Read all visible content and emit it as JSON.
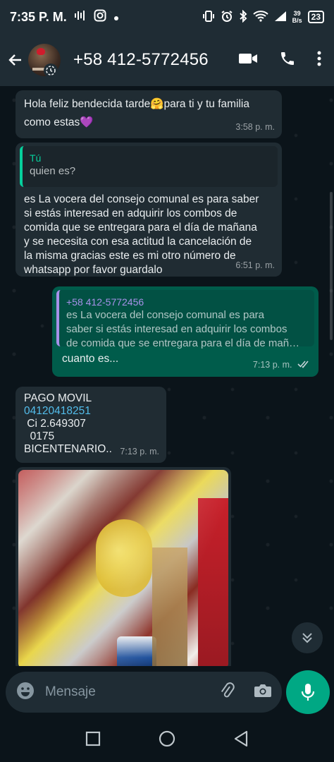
{
  "status_bar": {
    "time": "7:35 P. M.",
    "net_speed_value": "39",
    "net_speed_unit": "B/s",
    "battery": "23"
  },
  "header": {
    "contact": "+58 412-5772456",
    "icons": [
      "back-arrow-icon",
      "video-call-icon",
      "voice-call-icon",
      "more-options-icon"
    ]
  },
  "messages": [
    {
      "direction": "incoming",
      "text_line1": "Hola feliz bendecida tarde🤗para ti y tu familia",
      "text_line2": "como estas💜",
      "time": "3:58 p. m."
    },
    {
      "direction": "incoming",
      "quote_author": "Tú",
      "quote_text": "quien es?",
      "text_lines": [
        "es La vocera del consejo comunal  es para saber",
        "si estás interesad en adquirir los combos  de",
        "comida que se entregara para el día de mañana",
        "y se necesita con esa actitud la cancelación de",
        "la misma gracias este es mi otro número de",
        "whatsapp por favor guardalo"
      ],
      "time": "6:51 p. m."
    },
    {
      "direction": "outgoing",
      "quote_author": "+58 412-5772456",
      "quote_lines": [
        "es La vocera del consejo comunal  es para",
        "saber si estás interesad en adquirir los combos",
        "de comida que se entregara para el día de mañ…"
      ],
      "text": "cuanto es...",
      "time": "7:13 p. m.",
      "status": "read"
    },
    {
      "direction": "incoming",
      "line1": "PAGO MOVIL",
      "phone_link": "04120418251",
      "line3": " Ci 2.649307",
      "line4": "  0175",
      "line5": "BICENTENARIO..",
      "time": "7:13 p. m."
    },
    {
      "direction": "incoming",
      "type": "image"
    }
  ],
  "composer": {
    "placeholder": "Mensaje"
  },
  "colors": {
    "background": "#0b141a",
    "bar": "#1f2c34",
    "incoming": "#202c33",
    "outgoing": "#005c4b",
    "accent": "#00a884"
  }
}
